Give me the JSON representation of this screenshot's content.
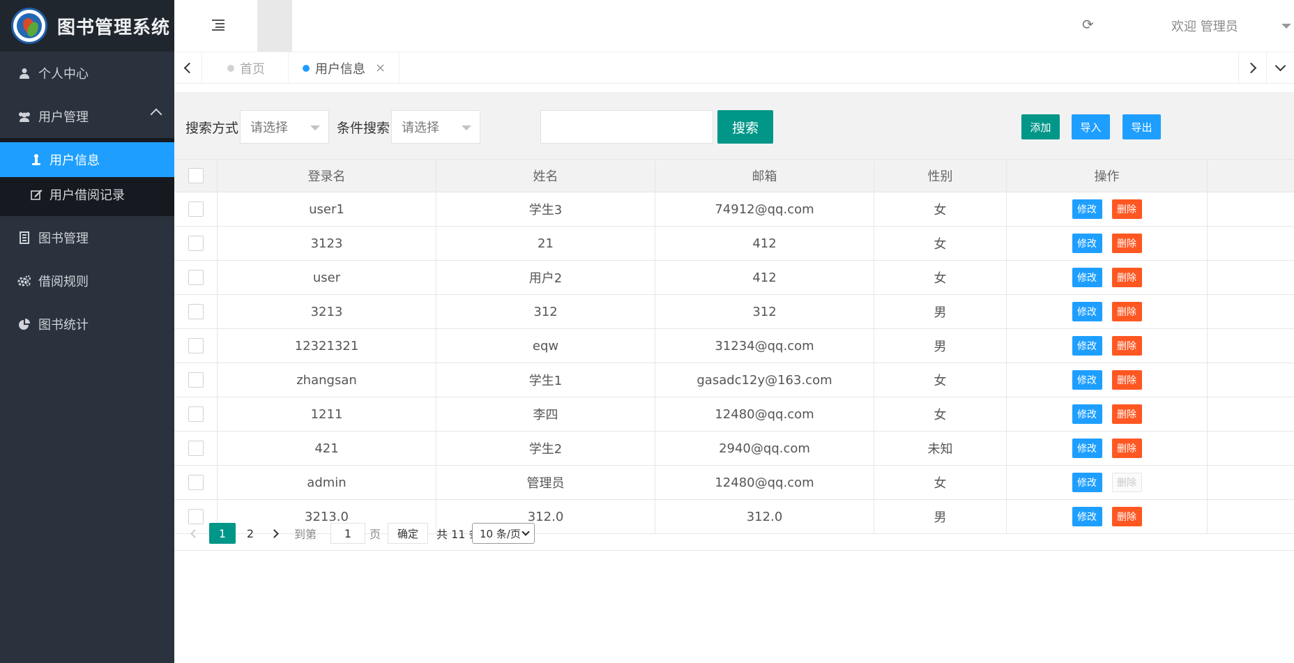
{
  "app": {
    "title": "图书管理系统"
  },
  "colors": {
    "sidebar_bg": "#2a323d",
    "active_blue": "#1e9fff",
    "primary_green": "#009688",
    "danger": "#ff5722"
  },
  "sidebar": {
    "items": [
      {
        "label": "个人中心",
        "icon": "user-icon"
      },
      {
        "label": "用户管理",
        "icon": "users-icon",
        "expanded": true,
        "children": [
          {
            "label": "用户信息",
            "icon": "person-icon",
            "active": true
          },
          {
            "label": "用户借阅记录",
            "icon": "edit-icon"
          }
        ]
      },
      {
        "label": "图书管理",
        "icon": "book-icon"
      },
      {
        "label": "借阅规则",
        "icon": "cogs-icon"
      },
      {
        "label": "图书统计",
        "icon": "pie-chart-icon"
      }
    ]
  },
  "header": {
    "welcome": "欢迎 管理员"
  },
  "tabs": [
    {
      "label": "首页"
    },
    {
      "label": "用户信息",
      "active": true,
      "close": "×"
    }
  ],
  "toolbar": {
    "search_mode_label": "搜索方式:",
    "search_mode_placeholder": "请选择",
    "condition_label": "条件搜索:",
    "condition_placeholder": "请选择",
    "search_value": "",
    "search_button": "搜索",
    "add_button": "添加",
    "import_button": "导入",
    "export_button": "导出"
  },
  "table": {
    "columns": [
      "登录名",
      "姓名",
      "邮箱",
      "性别",
      "操作"
    ],
    "edit_label": "修改",
    "delete_label": "删除",
    "rows": [
      {
        "login": "user1",
        "name": "学生3",
        "email": "74912@qq.com",
        "gender": "女",
        "delete_disabled": false
      },
      {
        "login": "3123",
        "name": "21",
        "email": "412",
        "gender": "女",
        "delete_disabled": false
      },
      {
        "login": "user",
        "name": "用户2",
        "email": "412",
        "gender": "女",
        "delete_disabled": false
      },
      {
        "login": "3213",
        "name": "312",
        "email": "312",
        "gender": "男",
        "delete_disabled": false
      },
      {
        "login": "12321321",
        "name": "eqw",
        "email": "31234@qq.com",
        "gender": "男",
        "delete_disabled": false
      },
      {
        "login": "zhangsan",
        "name": "学生1",
        "email": "gasadc12y@163.com",
        "gender": "女",
        "delete_disabled": false
      },
      {
        "login": "1211",
        "name": "李四",
        "email": "12480@qq.com",
        "gender": "女",
        "delete_disabled": false
      },
      {
        "login": "421",
        "name": "学生2",
        "email": "2940@qq.com",
        "gender": "未知",
        "delete_disabled": false
      },
      {
        "login": "admin",
        "name": "管理员",
        "email": "12480@qq.com",
        "gender": "女",
        "delete_disabled": true
      },
      {
        "login": "3213.0",
        "name": "312.0",
        "email": "312.0",
        "gender": "男",
        "delete_disabled": false
      }
    ]
  },
  "pagination": {
    "pages": [
      "1",
      "2"
    ],
    "current": "1",
    "goto_label": "到第",
    "goto_value": "1",
    "page_label": "页",
    "confirm_label": "确定",
    "total_label": "共 11 条",
    "page_size": "10 条/页"
  }
}
